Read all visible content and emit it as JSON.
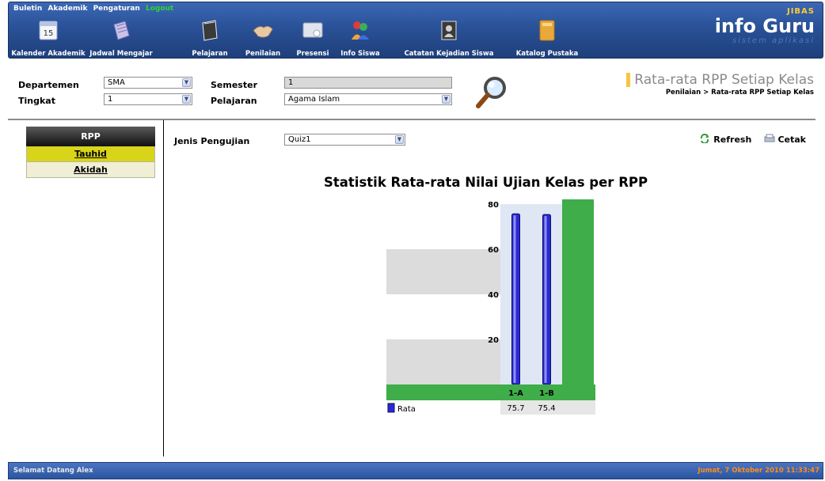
{
  "top_menu": {
    "buletin": "Buletin",
    "akademik": "Akademik",
    "pengaturan": "Pengaturan",
    "logout": "Logout"
  },
  "nav": [
    {
      "label": "Kalender Akademik",
      "icon": "calendar-icon",
      "icon_text": "15"
    },
    {
      "label": "Jadwal Mengajar",
      "icon": "schedule-icon"
    },
    {
      "label": "Pelajaran",
      "icon": "book-icon"
    },
    {
      "label": "Penilaian",
      "icon": "handshake-icon"
    },
    {
      "label": "Presensi",
      "icon": "attendance-icon"
    },
    {
      "label": "Info Siswa",
      "icon": "students-icon"
    },
    {
      "label": "Catatan Kejadian Siswa",
      "icon": "notes-icon"
    },
    {
      "label": "Katalog Pustaka",
      "icon": "library-icon"
    }
  ],
  "brand": {
    "jibas": "JIBAS",
    "name": "info Guru",
    "ghost": "sistem aplikasi"
  },
  "filters": {
    "departemen_label": "Departemen",
    "departemen_value": "SMA",
    "tingkat_label": "Tingkat",
    "tingkat_value": "1",
    "semester_label": "Semester",
    "semester_value": "1",
    "pelajaran_label": "Pelajaran",
    "pelajaran_value": "Agama Islam"
  },
  "page": {
    "title": "Rata-rata RPP Setiap Kelas",
    "breadcrumb": "Penilaian  >  Rata-rata RPP Setiap Kelas"
  },
  "sidebar": {
    "header": "RPP",
    "items": [
      {
        "label": "Tauhid",
        "active": true
      },
      {
        "label": "Akidah",
        "active": false
      }
    ]
  },
  "main": {
    "jenis_label": "Jenis Pengujian",
    "jenis_value": "Quiz1",
    "refresh_label": "Refresh",
    "cetak_label": "Cetak"
  },
  "chart_data": {
    "type": "bar",
    "title": "Statistik Rata-rata Nilai Ujian Kelas per RPP",
    "categories": [
      "1-A",
      "1-B"
    ],
    "series": [
      {
        "name": "Rata",
        "values": [
          75.7,
          75.4
        ]
      }
    ],
    "ylim": [
      0,
      80
    ],
    "yticks": [
      20,
      40,
      60,
      80
    ],
    "value_labels": [
      "75.7",
      "75.4"
    ],
    "colors": {
      "bar": "#2a2ad0",
      "wall": "#3fad4a",
      "band": "#dcdcdc",
      "plot_bg": "#dfe7f5"
    }
  },
  "footer": {
    "welcome": "Selamat Datang Alex",
    "date": "Jumat, 7 Oktober 2010 11:33:47"
  }
}
